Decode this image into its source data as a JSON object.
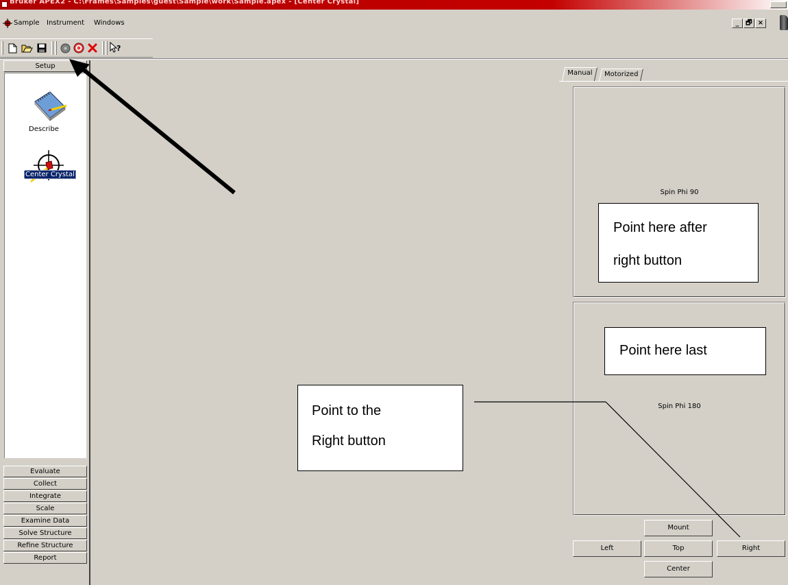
{
  "window": {
    "title": "Bruker APEX2 - C:\\Frames\\Samples\\guest\\Sample\\work\\Sample.apex - [Center Crystal]"
  },
  "menu": {
    "items": [
      "Sample",
      "Instrument",
      "Windows"
    ],
    "mdi_buttons": [
      "_",
      "🗗",
      "×"
    ]
  },
  "toolbar": {
    "buttons": [
      "new-file",
      "open-folder",
      "save",
      "disc",
      "target",
      "delete",
      "context-help"
    ]
  },
  "sidebar": {
    "top_button": "Setup",
    "items": [
      {
        "label": "Describe"
      },
      {
        "label": "Center Crystal",
        "selected": true
      }
    ],
    "bottom_buttons": [
      "Evaluate",
      "Collect",
      "Integrate",
      "Scale",
      "Examine Data",
      "Solve Structure",
      "Refine Structure",
      "Report"
    ]
  },
  "right_panel": {
    "tabs": [
      {
        "label": "Manual",
        "active": true
      },
      {
        "label": "Motorized",
        "active": false
      }
    ],
    "views": [
      {
        "label": "Spin Phi 90"
      },
      {
        "label": "Spin Phi 180"
      }
    ],
    "buttons": {
      "mount": "Mount",
      "left": "Left",
      "top": "Top",
      "right": "Right",
      "center": "Center"
    }
  },
  "callouts": {
    "after_right": [
      "Point here after",
      "right button"
    ],
    "last": "Point here last",
    "right_button": [
      "Point to the",
      "Right button"
    ]
  }
}
